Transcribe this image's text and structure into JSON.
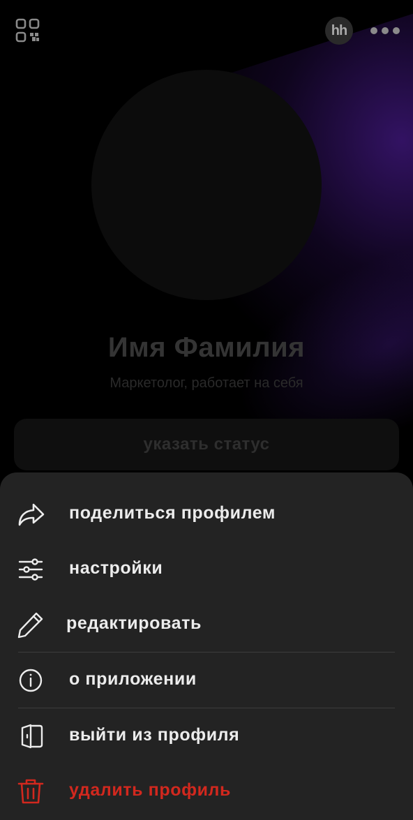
{
  "profile": {
    "hh_badge": "hh",
    "name": "Имя Фамилия",
    "subtitle": "Маркетолог, работает на себя",
    "status_button": "указать статус"
  },
  "menu": {
    "items": [
      {
        "label": "поделиться профилем",
        "icon": "share-icon"
      },
      {
        "label": "настройки",
        "icon": "sliders-icon"
      },
      {
        "label": "редактировать",
        "icon": "pencil-icon"
      },
      {
        "label": "о приложении",
        "icon": "info-icon"
      },
      {
        "label": "выйти из профиля",
        "icon": "logout-icon"
      },
      {
        "label": "удалить профиль",
        "icon": "trash-icon"
      }
    ]
  },
  "colors": {
    "background": "#000000",
    "sheet": "#232323",
    "text": "#ececec",
    "danger": "#d2281e"
  }
}
